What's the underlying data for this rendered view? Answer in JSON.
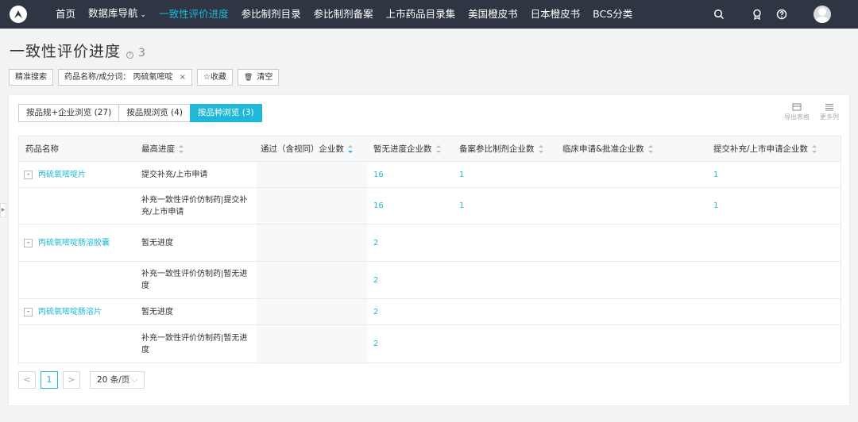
{
  "topnav": {
    "items": [
      {
        "label": "首页",
        "active": false
      },
      {
        "label": "数据库导航",
        "active": false,
        "caret": "⌄"
      },
      {
        "label": "一致性评价进度",
        "active": true
      },
      {
        "label": "参比制剂目录",
        "active": false
      },
      {
        "label": "参比制剂备案",
        "active": false
      },
      {
        "label": "上市药品目录集",
        "active": false
      },
      {
        "label": "美国橙皮书",
        "active": false
      },
      {
        "label": "日本橙皮书",
        "active": false
      },
      {
        "label": "BCS分类",
        "active": false
      }
    ],
    "icons": [
      "search-icon",
      "badge-icon",
      "help-icon",
      "user-avatar"
    ]
  },
  "page": {
    "title": "一致性评价进度",
    "count": "3"
  },
  "filters": {
    "exact_search": "精准搜索",
    "keyword_tag": "药品名称/成分词：  丙硫氧嘧啶",
    "tag_close": "×",
    "favorite": "☆收藏",
    "clear_icon": "🗑",
    "clear": "清空"
  },
  "tabs": [
    {
      "label": "按品规+企业浏览 (27)",
      "active": false
    },
    {
      "label": "按品规浏览 (4)",
      "active": false
    },
    {
      "label": "按品种浏览 (3)",
      "active": true
    }
  ],
  "tools": {
    "export": "导出表格",
    "more": "更多列"
  },
  "table": {
    "headers": [
      "药品名称",
      "最高进度",
      "通过（含视同）企业数",
      "暂无进度企业数",
      "备案参比制剂企业数",
      "临床申请&批准企业数",
      "提交补充/上市申请企业数"
    ],
    "groups": [
      {
        "name": "丙硫氧嘧啶片",
        "rows": [
          {
            "progress": "提交补充/上市申请",
            "passed": "",
            "none": "16",
            "ref": "1",
            "clinical": "",
            "submit": "1"
          },
          {
            "progress": "补充一致性评价仿制药|提交补充/上市申请",
            "passed": "",
            "none": "16",
            "ref": "1",
            "clinical": "",
            "submit": "1"
          }
        ]
      },
      {
        "name": "丙硫氧嘧啶肠溶胶囊",
        "rows": [
          {
            "progress": "暂无进度",
            "passed": "",
            "none": "2",
            "ref": "",
            "clinical": "",
            "submit": ""
          },
          {
            "progress": "补充一致性评价仿制药|暂无进度",
            "passed": "",
            "none": "2",
            "ref": "",
            "clinical": "",
            "submit": ""
          }
        ]
      },
      {
        "name": "丙硫氧嘧啶肠溶片",
        "rows": [
          {
            "progress": "暂无进度",
            "passed": "",
            "none": "2",
            "ref": "",
            "clinical": "",
            "submit": ""
          },
          {
            "progress": "补充一致性评价仿制药|暂无进度",
            "passed": "",
            "none": "2",
            "ref": "",
            "clinical": "",
            "submit": ""
          }
        ]
      }
    ]
  },
  "pagination": {
    "prev": "<",
    "current": "1",
    "next": ">",
    "page_size": "20 条/页"
  },
  "colors": {
    "accent": "#1fb8d6",
    "topbar": "#2f3542"
  }
}
